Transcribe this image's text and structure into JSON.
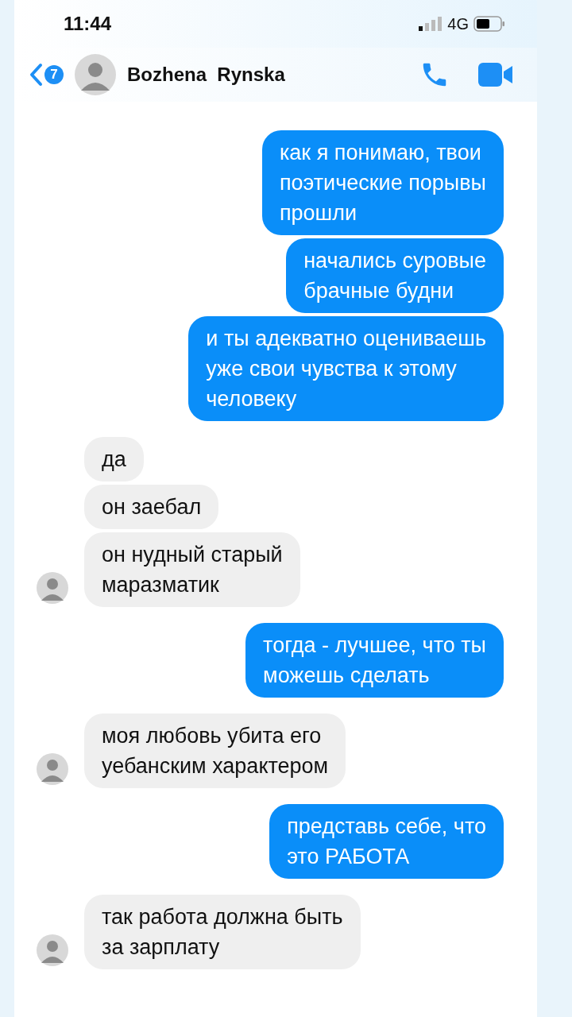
{
  "status_bar": {
    "time": "11:44",
    "network": "4G"
  },
  "header": {
    "back_count": "7",
    "contact_name": "Bozhena  Rynska"
  },
  "messages": [
    {
      "kind": "outgoing",
      "text": "как я понимаю, твои\nпоэтические порывы\nпрошли"
    },
    {
      "kind": "outgoing",
      "text": "начались суровые\nбрачные будни"
    },
    {
      "kind": "outgoing",
      "text": "и ты адекватно оцениваешь\nуже свои чувства к этому\nчеловеку"
    },
    {
      "kind": "incoming",
      "text": "да",
      "avatar": false
    },
    {
      "kind": "incoming",
      "text": "он заебал",
      "avatar": false
    },
    {
      "kind": "incoming",
      "text": "он нудный старый\nмаразматик",
      "avatar": true
    },
    {
      "kind": "outgoing",
      "text": "тогда - лучшее, что ты\nможешь сделать"
    },
    {
      "kind": "incoming",
      "text": "моя любовь убита его\nуебанским характером",
      "avatar": true
    },
    {
      "kind": "outgoing",
      "text": "представь себе, что\nэто РАБОТА"
    },
    {
      "kind": "incoming",
      "text": "так работа должна быть\nза зарплату",
      "avatar": true
    }
  ]
}
